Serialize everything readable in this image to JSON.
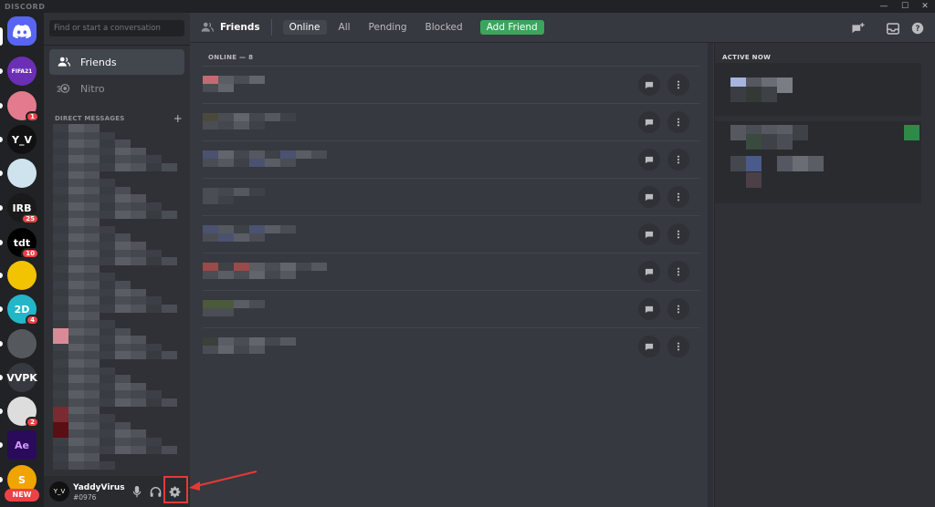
{
  "window": {
    "brand": "DISCORD",
    "controls": [
      "—",
      "☐",
      "✕"
    ]
  },
  "servers": {
    "home_icon": "discord-logo-icon",
    "items": [
      {
        "label": "FIFA21",
        "color": "#6a2fb5",
        "badge": ""
      },
      {
        "label": "",
        "color": "#e37a8d",
        "badge": "1"
      },
      {
        "label": "Y_V",
        "color": "#111111",
        "badge": ""
      },
      {
        "label": "",
        "color": "#cfe3ef",
        "badge": ""
      },
      {
        "label": "IRB",
        "color": "#1a1a1a",
        "badge": "25"
      },
      {
        "label": "tdt",
        "color": "#000000",
        "badge": "10"
      },
      {
        "label": "",
        "color": "#f2c300",
        "badge": ""
      },
      {
        "label": "2D",
        "color": "#23b6c9",
        "badge": "4"
      },
      {
        "label": "",
        "color": "#55585c",
        "badge": ""
      },
      {
        "label": "VVPK",
        "color": "#36393f",
        "badge": ""
      },
      {
        "label": "",
        "color": "#dddddd",
        "badge": "2"
      },
      {
        "label": "Ae",
        "color": "#2a0a5a",
        "badge": ""
      },
      {
        "label": "S",
        "color": "#f0a400",
        "badge": ""
      }
    ],
    "new_badge": "NEW"
  },
  "sidebar": {
    "search_placeholder": "Find or start a conversation",
    "nav": {
      "friends": "Friends",
      "nitro": "Nitro"
    },
    "dm_header": "DIRECT MESSAGES",
    "dm_add": "+"
  },
  "user": {
    "name": "YaddyVirus",
    "tag": "#0976",
    "avatar_text": "Y_V"
  },
  "header": {
    "title": "Friends",
    "tabs": [
      "Online",
      "All",
      "Pending",
      "Blocked"
    ],
    "add_friend": "Add Friend"
  },
  "friends": {
    "section_label": "ONLINE — 8",
    "row_count": 8
  },
  "active_now": {
    "label": "ACTIVE NOW"
  },
  "colors": {
    "accent": "#5865f2",
    "green": "#3ba55d",
    "red": "#ed4245",
    "annotation": "#e53935"
  }
}
